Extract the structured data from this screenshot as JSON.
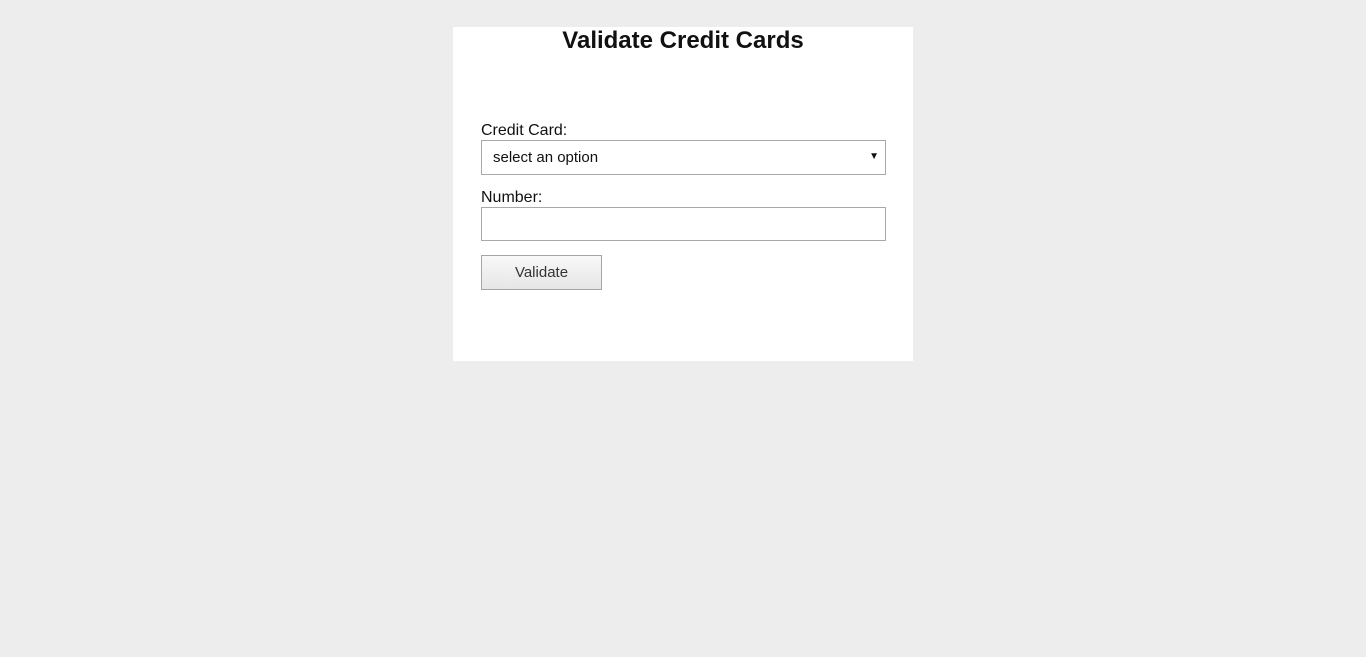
{
  "form": {
    "title": "Validate Credit Cards",
    "credit_card_label": "Credit Card:",
    "credit_card_selected": "select an option",
    "number_label": "Number:",
    "number_value": "",
    "number_placeholder": "",
    "validate_label": "Validate"
  },
  "colors": {
    "background": "#ededed",
    "card": "#ffffff",
    "border": "#a9a9a9"
  },
  "icons": {
    "select_arrow": "chevron-down-icon"
  }
}
